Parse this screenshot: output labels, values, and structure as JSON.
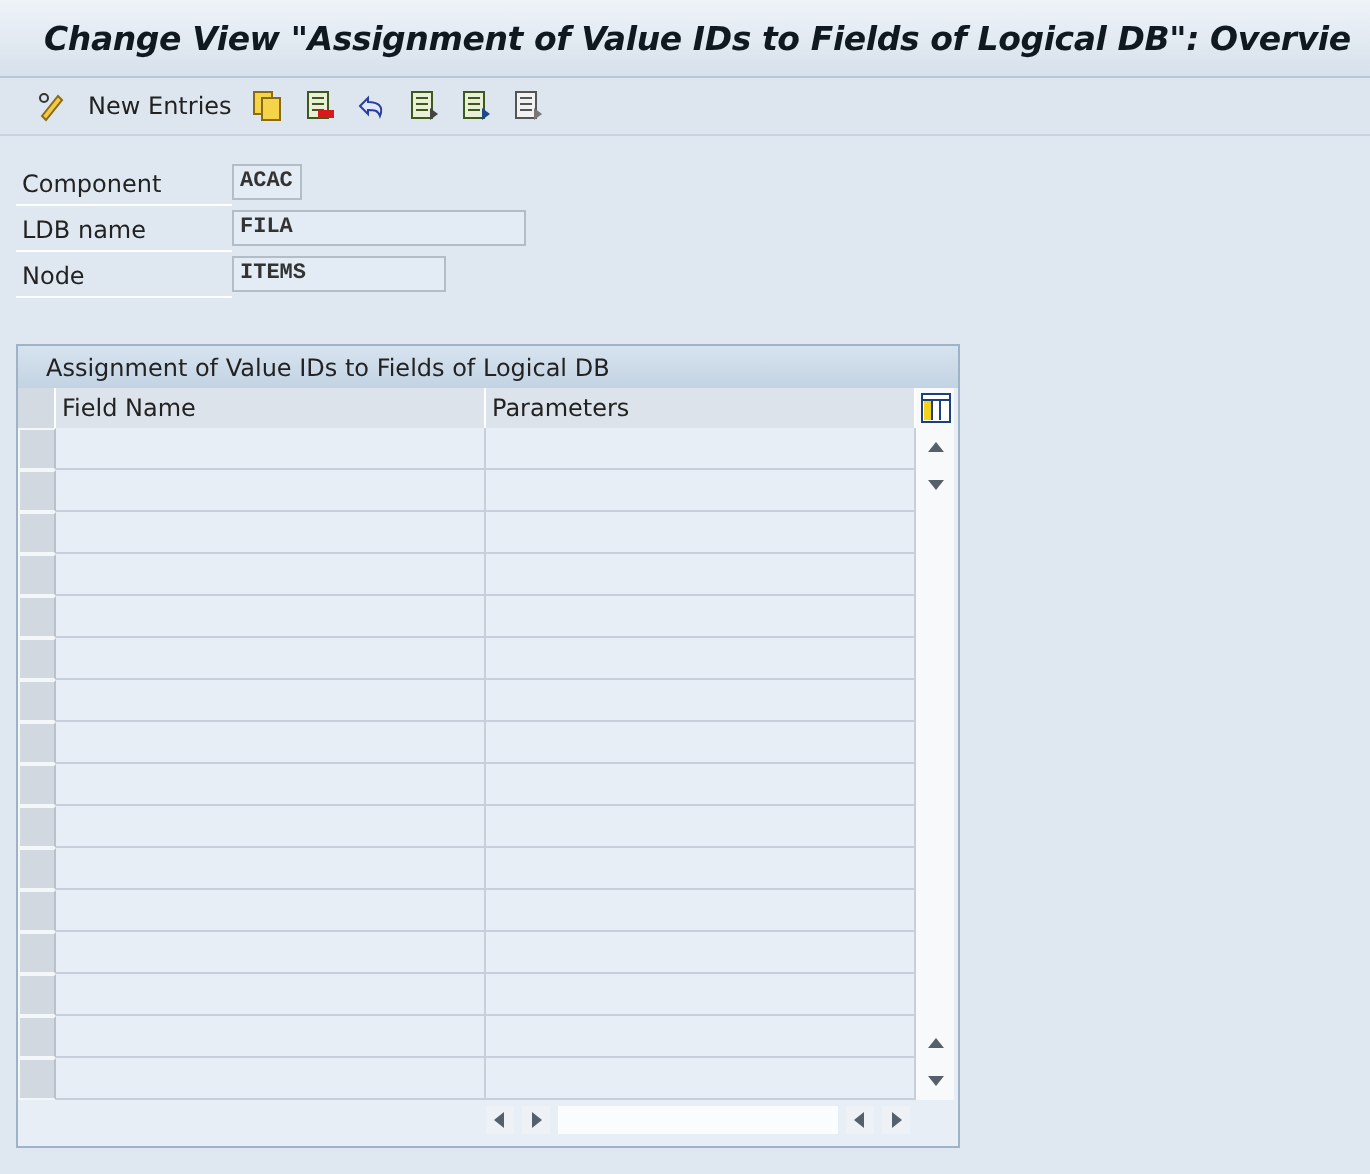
{
  "window": {
    "title": "Change View \"Assignment of Value IDs to Fields of Logical DB\": Overvie"
  },
  "toolbar": {
    "new_entries": "New Entries"
  },
  "fields": [
    {
      "label": "Component",
      "value": "ACAC"
    },
    {
      "label": "LDB name",
      "value": "FILA"
    },
    {
      "label": "Node",
      "value": "ITEMS"
    }
  ],
  "table": {
    "title": "Assignment of Value IDs to Fields of Logical DB",
    "columns": [
      "Field Name",
      "Parameters"
    ]
  }
}
